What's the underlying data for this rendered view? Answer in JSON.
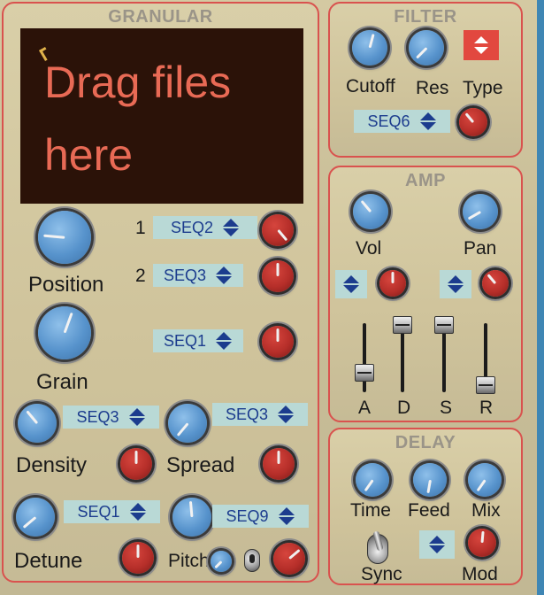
{
  "granular": {
    "title": "GRANULAR",
    "dropzone_text": "Drag files here",
    "position_label": "Position",
    "grain_label": "Grain",
    "density_label": "Density",
    "spread_label": "Spread",
    "detune_label": "Detune",
    "pitch_label": "Pitch",
    "mod_row_1_number": "1",
    "mod_row_2_number": "2",
    "seq_position_1": "SEQ2",
    "seq_position_2": "SEQ3",
    "seq_grain": "SEQ1",
    "seq_density": "SEQ3",
    "seq_spread": "SEQ3",
    "seq_detune": "SEQ1",
    "seq_pitch": "SEQ9"
  },
  "filter": {
    "title": "FILTER",
    "cutoff_label": "Cutoff",
    "res_label": "Res",
    "type_label": "Type",
    "seq": "SEQ6"
  },
  "amp": {
    "title": "AMP",
    "vol_label": "Vol",
    "pan_label": "Pan",
    "a_label": "A",
    "d_label": "D",
    "s_label": "S",
    "r_label": "R"
  },
  "delay": {
    "title": "DELAY",
    "time_label": "Time",
    "feed_label": "Feed",
    "mix_label": "Mix",
    "sync_label": "Sync",
    "mod_label": "Mod"
  },
  "colors": {
    "panel_border": "#d9524e",
    "knob_blue": "#5793cc",
    "knob_red": "#b52e29",
    "seq_bg": "#b9d9d6",
    "seq_text": "#1c3c8e",
    "dropzone_bg": "#2b1208",
    "dropzone_text": "#e86a55"
  }
}
